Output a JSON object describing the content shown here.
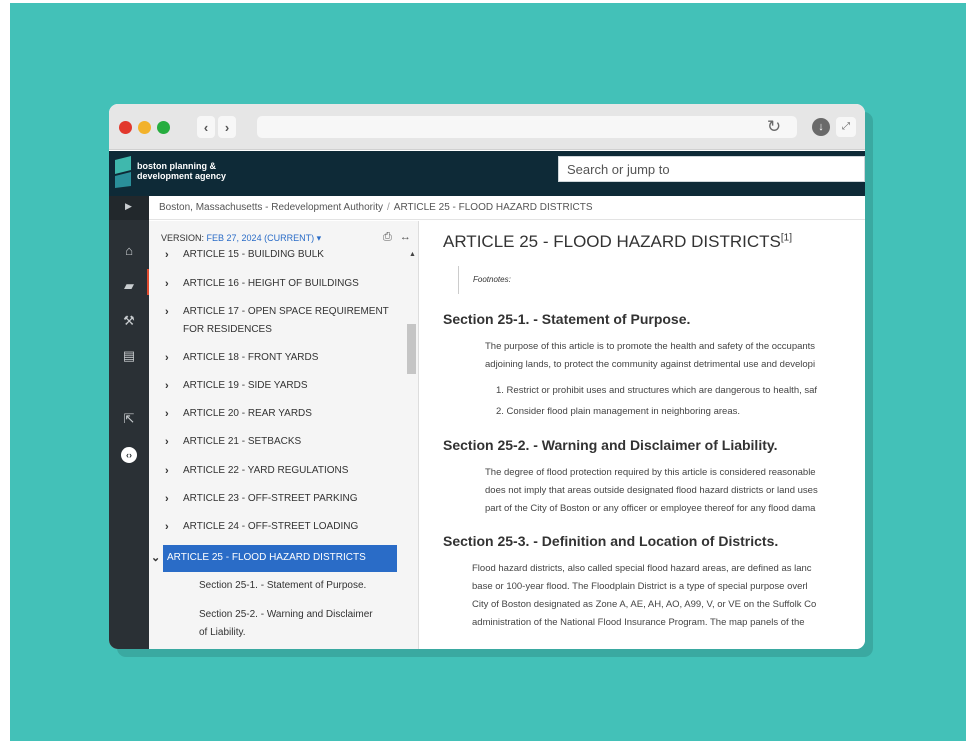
{
  "site": {
    "logo_line1": "boston planning &",
    "logo_line2": "development agency",
    "search_placeholder": "Search or jump to"
  },
  "breadcrumb": {
    "parent": "Boston, Massachusetts - Redevelopment Authority",
    "separator": "/",
    "current": "ARTICLE 25 - FLOOD HAZARD DISTRICTS"
  },
  "toc": {
    "version_label": "VERSION:",
    "version_value": "FEB 27, 2024 (CURRENT)",
    "items": [
      "ARTICLE 15 - BUILDING BULK",
      "ARTICLE 16 - HEIGHT OF BUILDINGS",
      "ARTICLE 17 - OPEN SPACE REQUIREMENT",
      "FOR RESIDENCES",
      "ARTICLE 18 - FRONT YARDS",
      "ARTICLE 19 - SIDE YARDS",
      "ARTICLE 20 - REAR YARDS",
      "ARTICLE 21 - SETBACKS",
      "ARTICLE 22 - YARD REGULATIONS",
      "ARTICLE 23 - OFF-STREET PARKING",
      "ARTICLE 24 - OFF-STREET LOADING"
    ],
    "active_item": "ARTICLE 25 - FLOOD HAZARD DISTRICTS",
    "sub_items": [
      "Section 25-1. - Statement of Purpose.",
      "Section 25-2. - Warning and Disclaimer",
      "of Liability."
    ]
  },
  "content": {
    "title": "ARTICLE 25 - FLOOD HAZARD DISTRICTS",
    "title_footnote": "[1]",
    "footnotes_label": "Footnotes:",
    "sections": [
      {
        "heading": "Section 25-1. - Statement of Purpose.",
        "lines": [
          "The purpose of this article is to promote the health and safety of the occupants",
          "adjoining lands, to protect the community against detrimental use and developi"
        ],
        "list": [
          "1.  Restrict or prohibit uses and structures which are dangerous to health, saf",
          "2.  Consider flood plain management in neighboring areas."
        ]
      },
      {
        "heading": "Section 25-2. - Warning and Disclaimer of Liability.",
        "lines": [
          "The degree of flood protection required by this article is considered reasonable",
          "does not imply that areas outside designated flood hazard districts or land uses",
          "part of the City of Boston or any officer or employee thereof for any flood dama"
        ]
      },
      {
        "heading": "Section 25-3. - Definition and Location of Districts.",
        "lines": [
          "Flood hazard districts, also called special flood hazard areas, are defined as lanc",
          "base or 100-year flood. The Floodplain District is a type of special purpose overl",
          "City of Boston designated as Zone A, AE, AH, AO, A99, V, or VE on the Suffolk Co",
          "administration of the National Flood Insurance Program. The map panels of the"
        ]
      }
    ]
  },
  "colors": {
    "background": "#43c1b8",
    "header": "#0e2a37",
    "accent": "#2a6cc7",
    "rail": "#2a3035"
  },
  "icons": [
    "back-arrow-icon",
    "forward-arrow-icon",
    "reload-icon",
    "download-icon",
    "fullscreen-icon",
    "home-icon",
    "book-icon",
    "gavel-icon",
    "document-icon",
    "external-link-icon",
    "chat-icon",
    "print-icon",
    "collapse-icon"
  ]
}
